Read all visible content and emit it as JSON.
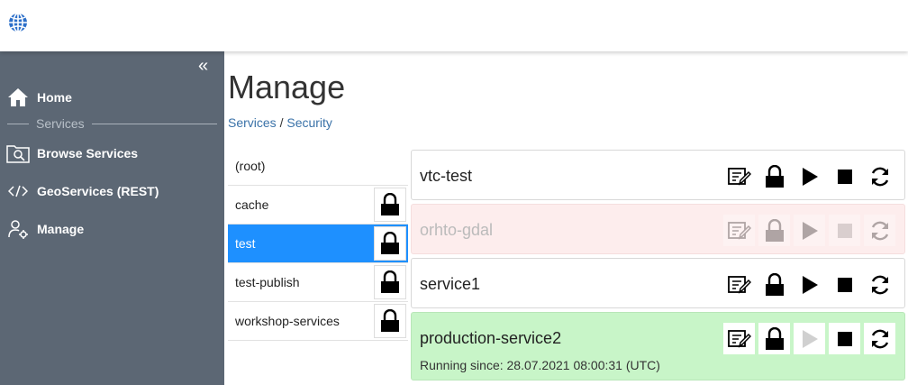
{
  "header": {
    "logo_icon": "globe-icon"
  },
  "sidebar": {
    "collapse_label": "«",
    "items": [
      {
        "label": "Home",
        "icon": "home-icon"
      },
      {
        "label": "Browse Services",
        "icon": "browse-icon"
      },
      {
        "label": "GeoServices (REST)",
        "icon": "code-icon"
      },
      {
        "label": "Manage",
        "icon": "users-gear-icon"
      }
    ],
    "section_label": "Services"
  },
  "main": {
    "title": "Manage",
    "breadcrumb": {
      "first": "Services",
      "separator": " / ",
      "second": "Security"
    }
  },
  "folders": [
    {
      "name": "(root)",
      "lock": false,
      "selected": false
    },
    {
      "name": "cache",
      "lock": true,
      "selected": false
    },
    {
      "name": "test",
      "lock": true,
      "selected": true
    },
    {
      "name": "test-publish",
      "lock": true,
      "selected": false
    },
    {
      "name": "workshop-services",
      "lock": true,
      "selected": false
    }
  ],
  "services": [
    {
      "name": "vtc-test",
      "state": "stopped",
      "since": ""
    },
    {
      "name": "orhto-gdal",
      "state": "error",
      "since": ""
    },
    {
      "name": "service1",
      "state": "stopped",
      "since": ""
    },
    {
      "name": "production-service2",
      "state": "running",
      "since": "Running since: 28.07.2021 08:00:31 (UTC)"
    }
  ],
  "colors": {
    "sidebar": "#5c6774",
    "selected": "#1e90ff",
    "running": "#c8f5c8",
    "error": "#fdeded",
    "link": "#3a72a8"
  }
}
